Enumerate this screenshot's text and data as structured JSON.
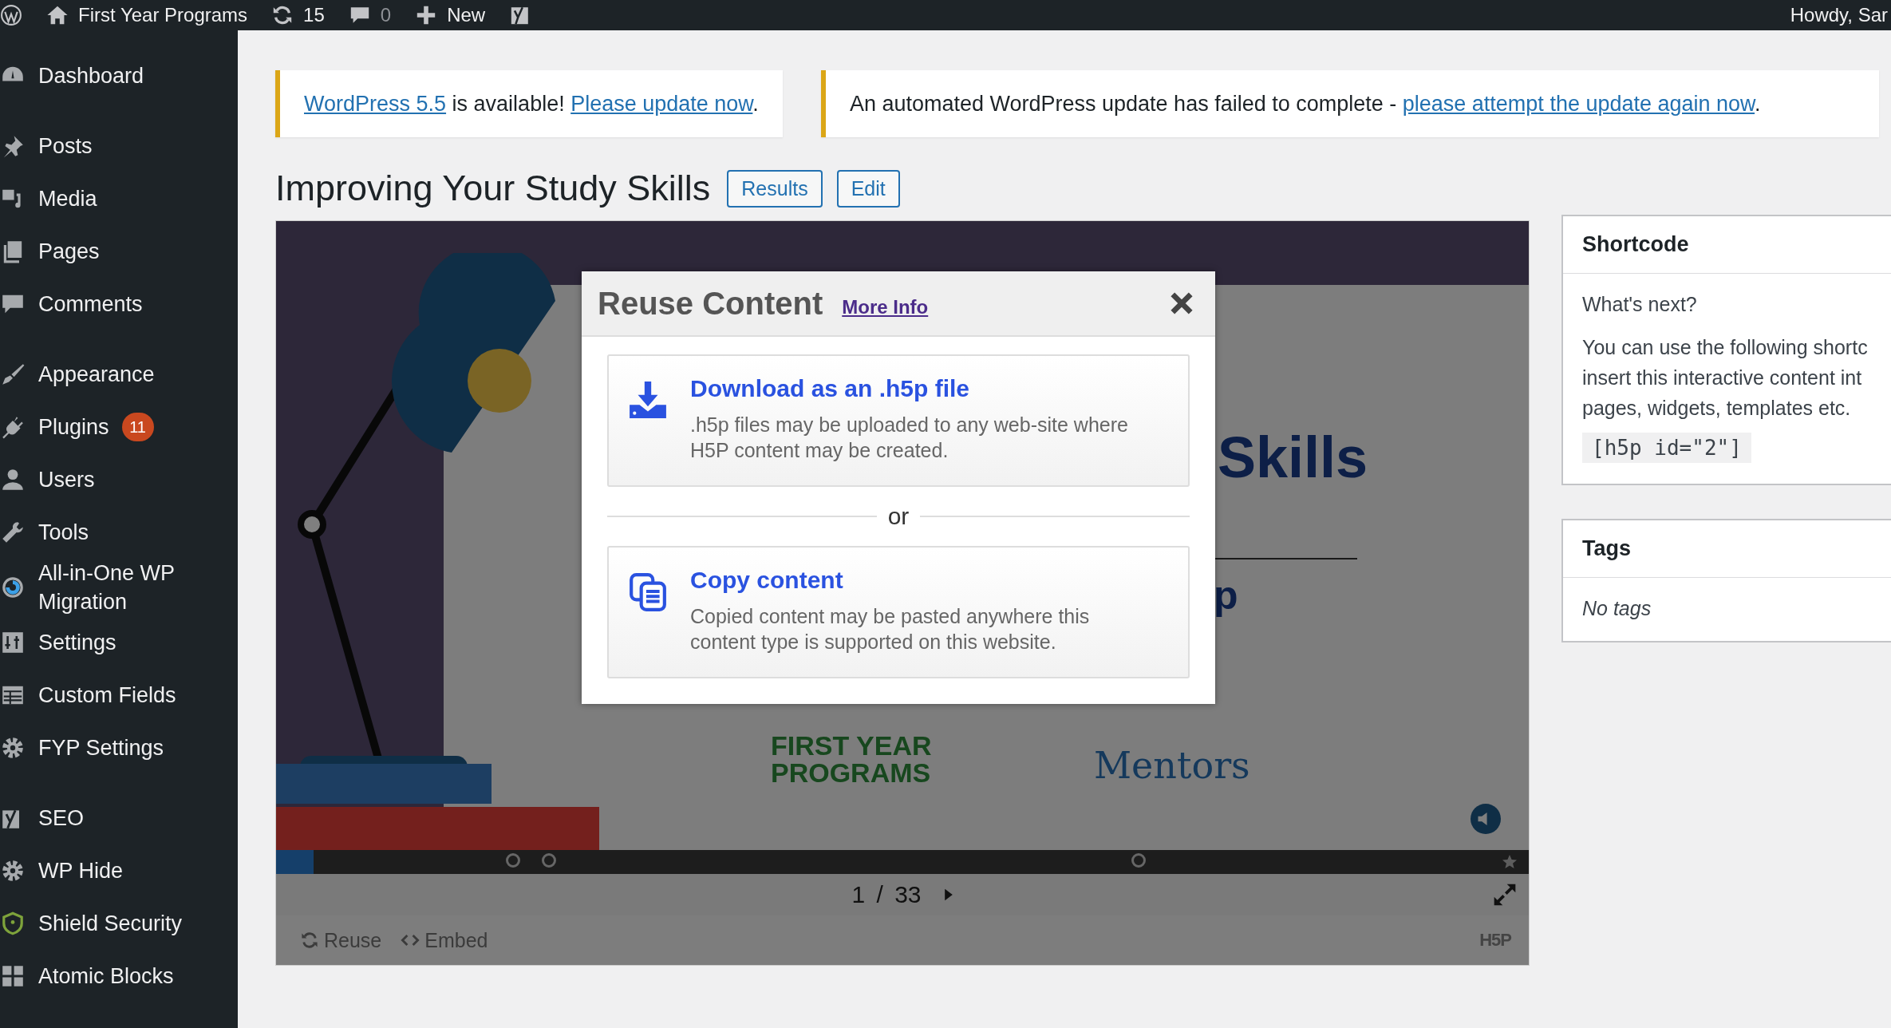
{
  "admin_bar": {
    "site": "First Year Programs",
    "updates": "15",
    "comments": "0",
    "new": "New",
    "greeting": "Howdy, Sar"
  },
  "sidebar": {
    "groups": [
      [
        {
          "kind": "dashboard",
          "label": "Dashboard"
        }
      ],
      [
        {
          "kind": "pin",
          "label": "Posts"
        },
        {
          "kind": "media",
          "label": "Media"
        },
        {
          "kind": "pages",
          "label": "Pages"
        },
        {
          "kind": "comment",
          "label": "Comments"
        }
      ],
      [
        {
          "kind": "brush",
          "label": "Appearance"
        },
        {
          "kind": "plug",
          "label": "Plugins",
          "badge": "11"
        },
        {
          "kind": "user",
          "label": "Users"
        },
        {
          "kind": "wrench",
          "label": "Tools"
        },
        {
          "kind": "migrate",
          "label": "All-in-One WP Migration"
        },
        {
          "kind": "sliders",
          "label": "Settings"
        },
        {
          "kind": "table",
          "label": "Custom Fields"
        },
        {
          "kind": "gear",
          "label": "FYP Settings"
        }
      ],
      [
        {
          "kind": "yoast",
          "label": "SEO"
        },
        {
          "kind": "gear",
          "label": "WP Hide"
        },
        {
          "kind": "shield",
          "label": "Shield Security"
        },
        {
          "kind": "blocks",
          "label": "Atomic Blocks"
        }
      ]
    ]
  },
  "notices": [
    {
      "parts": [
        {
          "text": "WordPress 5.5",
          "link": true
        },
        {
          "text": " is available! ",
          "link": false
        },
        {
          "text": "Please update now",
          "link": true
        },
        {
          "text": ".",
          "link": false
        }
      ]
    },
    {
      "parts": [
        {
          "text": "An automated WordPress update has failed to complete - ",
          "link": false
        },
        {
          "text": "please attempt the update again now",
          "link": true
        },
        {
          "text": ".",
          "link": false
        }
      ]
    }
  ],
  "page_title": "Improving Your Study Skills",
  "title_buttons": [
    "Results",
    "Edit"
  ],
  "h5p": {
    "slide": {
      "heading": "Skills",
      "subheading": "p",
      "logos": [
        "FIRST YEAR PROGRAMS",
        "Mentors"
      ]
    },
    "progress": {
      "level": 0.03
    },
    "page": "1 / 33",
    "actions": [
      {
        "kind": "reuse",
        "label": "Reuse"
      },
      {
        "kind": "embed",
        "label": "Embed"
      }
    ],
    "logo": "H5P",
    "modal": {
      "title": "Reuse Content",
      "more_info": "More Info",
      "separator": "or",
      "options": [
        {
          "kind": "download",
          "title": "Download as an .h5p file",
          "description": ".h5p files may be uploaded to any web-site where H5P content may be created."
        },
        {
          "kind": "copy",
          "title": "Copy content",
          "description": "Copied content may be pasted anywhere this content type is supported on this website."
        }
      ]
    }
  },
  "shortcode": {
    "title": "Shortcode",
    "question": "What's next?",
    "lines": [
      "You can use the following shortc",
      "insert this interactive content int",
      "pages, widgets, templates etc."
    ],
    "code": "[h5p id=\"2\"]"
  },
  "tags": {
    "title": "Tags",
    "empty": "No tags"
  }
}
